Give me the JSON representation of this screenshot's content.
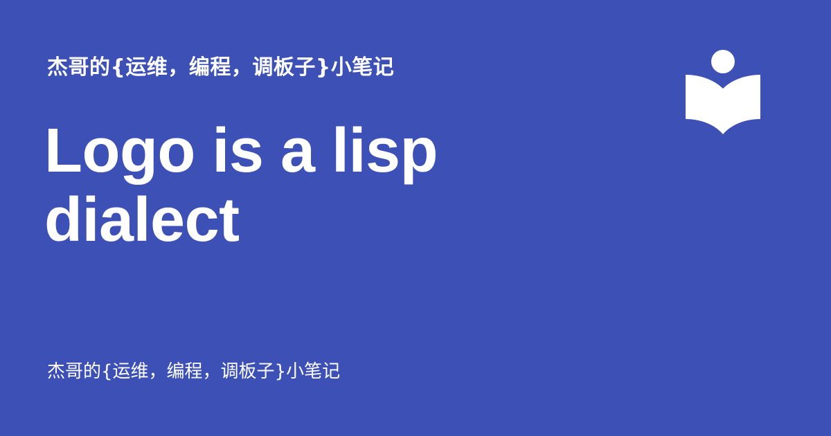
{
  "header": {
    "site_title": "杰哥的{运维，编程，调板子}小笔记"
  },
  "main": {
    "post_title": "Logo is a lisp dialect"
  },
  "footer": {
    "site_name": "杰哥的{运维，编程，调板子}小笔记"
  },
  "logo": {
    "icon": "reading-person-book-icon"
  },
  "colors": {
    "background": "#3d50b5",
    "text": "#ffffff"
  }
}
